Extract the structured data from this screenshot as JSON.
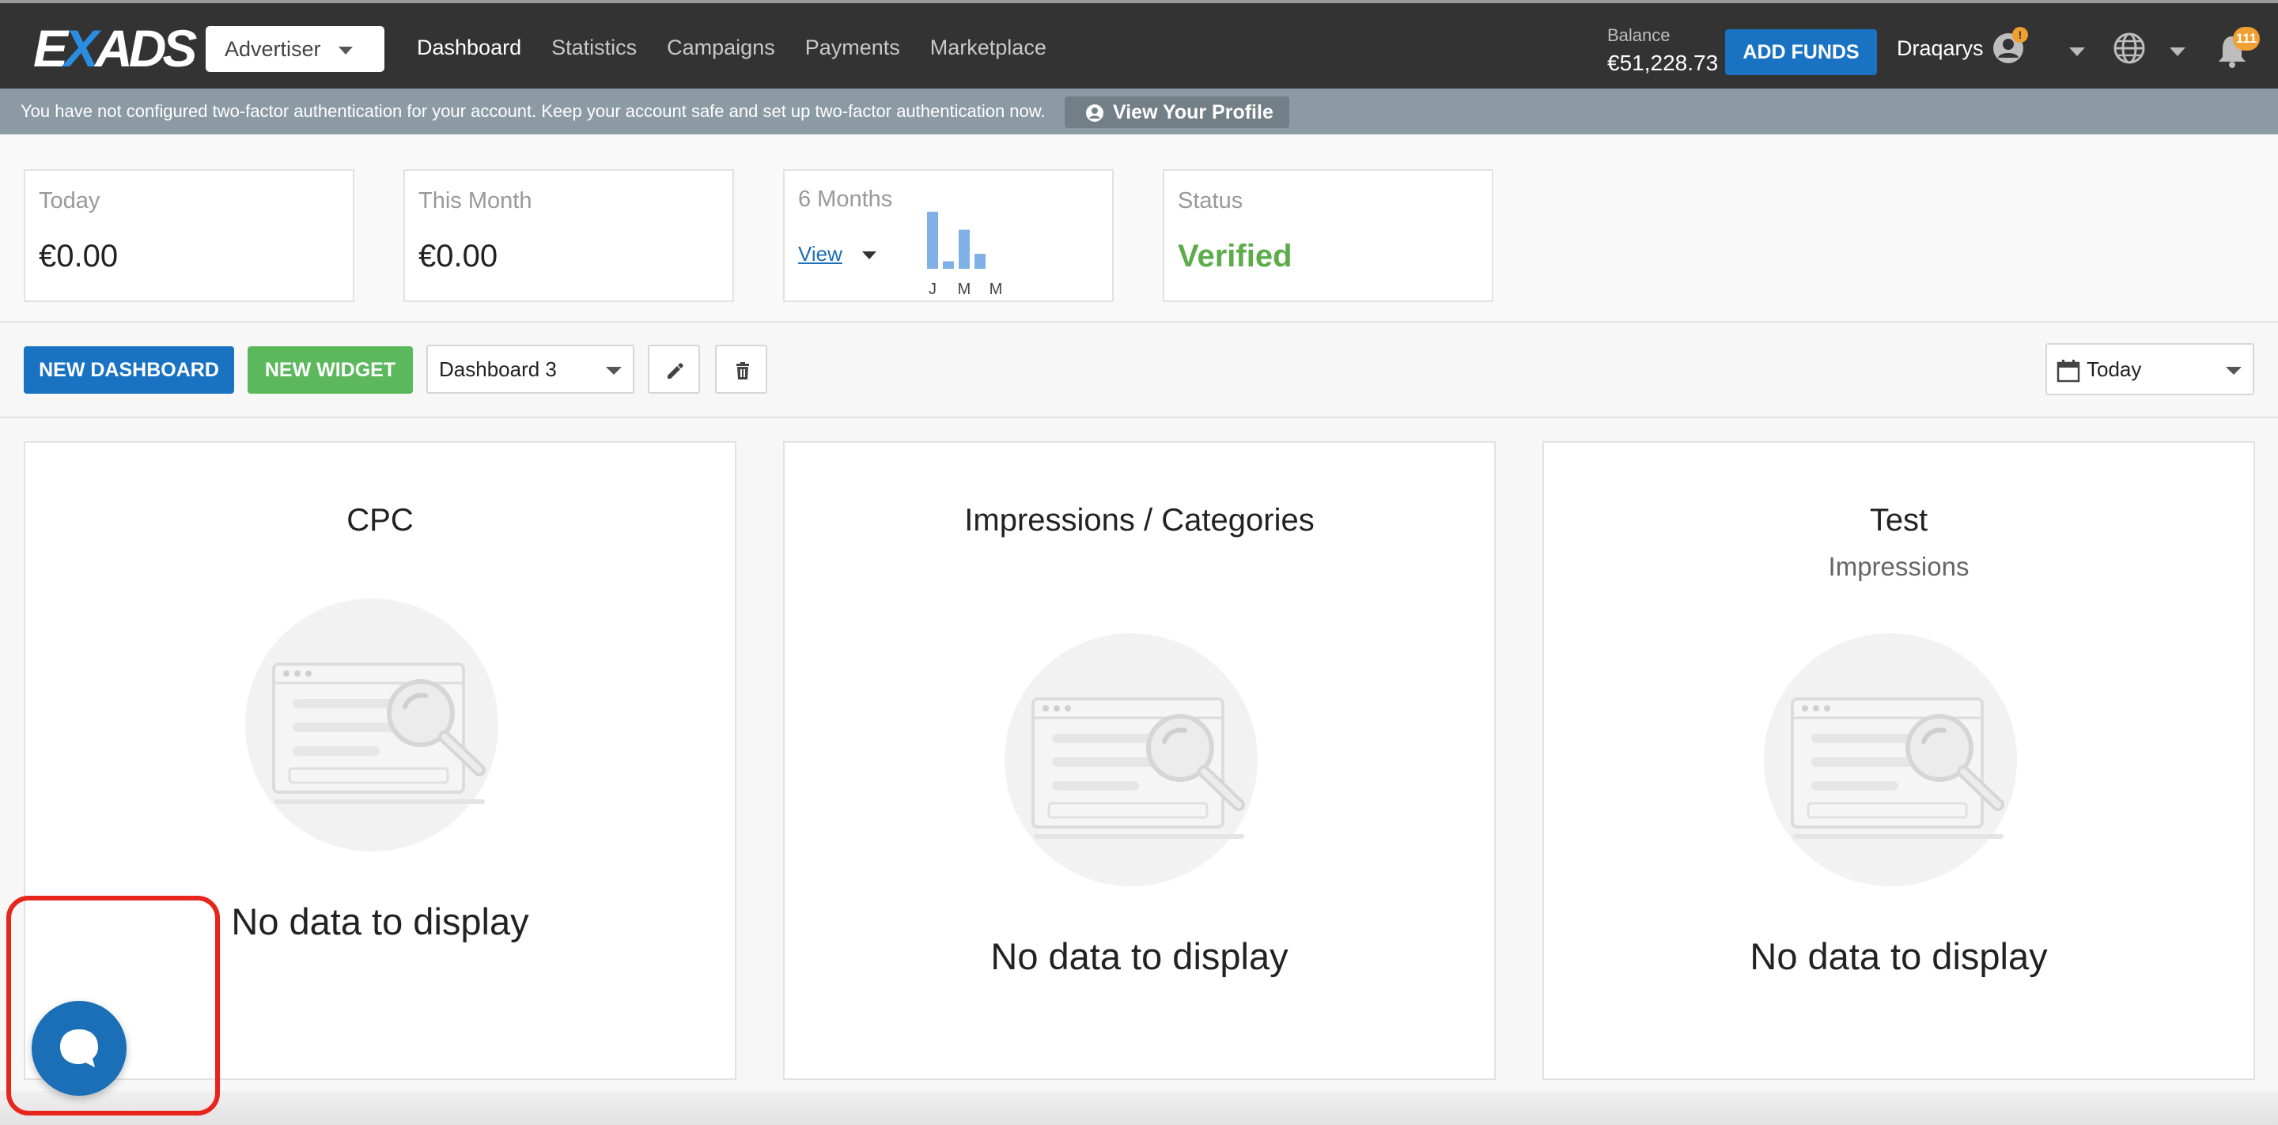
{
  "header": {
    "logo": {
      "prefix": "E",
      "x": "X",
      "suffix": "ADS"
    },
    "role": "Advertiser",
    "nav": [
      {
        "label": "Dashboard",
        "active": true
      },
      {
        "label": "Statistics"
      },
      {
        "label": "Campaigns"
      },
      {
        "label": "Payments"
      },
      {
        "label": "Marketplace"
      }
    ],
    "balance_label": "Balance",
    "balance_value": "€51,228.73",
    "add_funds": "ADD FUNDS",
    "username": "Draqarys",
    "avatar_badge": "!",
    "notification_count": "111"
  },
  "banner": {
    "text": "You have not configured two-factor authentication for your account. Keep your account safe and set up two-factor authentication now.",
    "button": "View Your Profile"
  },
  "summary": {
    "today": {
      "label": "Today",
      "value": "€0.00"
    },
    "month": {
      "label": "This Month",
      "value": "€0.00"
    },
    "six_months": {
      "label": "6 Months",
      "view": "View"
    },
    "status": {
      "label": "Status",
      "value": "Verified"
    }
  },
  "chart_data": {
    "type": "bar",
    "categories": [
      "J",
      "",
      "M",
      "",
      "M",
      ""
    ],
    "values": [
      38,
      5,
      26,
      10,
      0,
      0
    ],
    "ylim": [
      0,
      40
    ],
    "color": "#7fb1e6"
  },
  "toolbar": {
    "new_dashboard": "NEW DASHBOARD",
    "new_widget": "NEW WIDGET",
    "dashboard_select": "Dashboard 3",
    "date_select": "Today"
  },
  "widgets": [
    {
      "title": "CPC",
      "subtitle": "",
      "empty": "No data to display"
    },
    {
      "title": "Impressions / Categories",
      "subtitle": "",
      "empty": "No data to display"
    },
    {
      "title": "Test",
      "subtitle": "Impressions",
      "empty": "No data to display"
    }
  ],
  "colors": {
    "topbar": "#333333",
    "primary": "#1a73c2",
    "success": "#5cb85c",
    "verified": "#5cac4a",
    "highlight": "#e8251c"
  }
}
